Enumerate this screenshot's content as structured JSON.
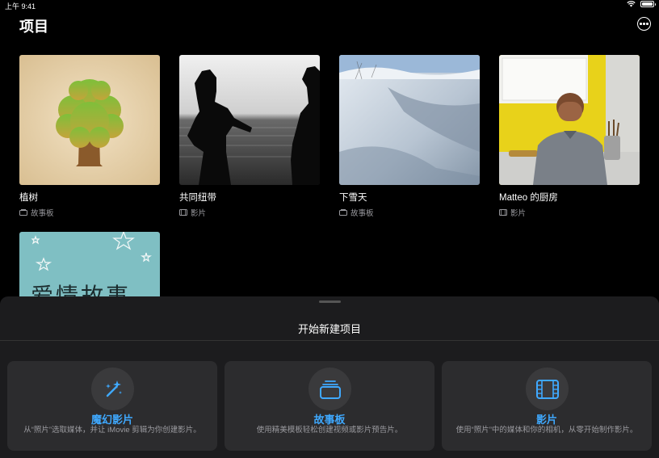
{
  "status_bar": {
    "time": "上午 9:41"
  },
  "header": {
    "title": "项目"
  },
  "projects": [
    {
      "name": "植树",
      "type": "故事板",
      "type_icon": "storyboard-icon"
    },
    {
      "name": "共同纽带",
      "type": "影片",
      "type_icon": "film-icon"
    },
    {
      "name": "下雪天",
      "type": "故事板",
      "type_icon": "storyboard-icon"
    },
    {
      "name": "Matteo 的厨房",
      "type": "影片",
      "type_icon": "film-icon"
    },
    {
      "name": "",
      "type": "",
      "thumbnail_text": "爱情故事"
    }
  ],
  "sheet": {
    "title": "开始新建项目",
    "options": [
      {
        "label": "魔幻影片",
        "description": "从“照片”选取媒体，并让 iMovie 剪辑为你创建影片。",
        "icon": "magic-wand-icon"
      },
      {
        "label": "故事板",
        "description": "使用精美模板轻松创建视频或影片预告片。",
        "icon": "storyboard-stack-icon"
      },
      {
        "label": "影片",
        "description": "使用“照片”中的媒体和你的相机，从零开始制作影片。",
        "icon": "film-strip-icon"
      }
    ]
  },
  "colors": {
    "accent": "#3fa9ff",
    "background": "#000000",
    "sheet": "#1c1c1e",
    "card": "#2c2c2e"
  }
}
